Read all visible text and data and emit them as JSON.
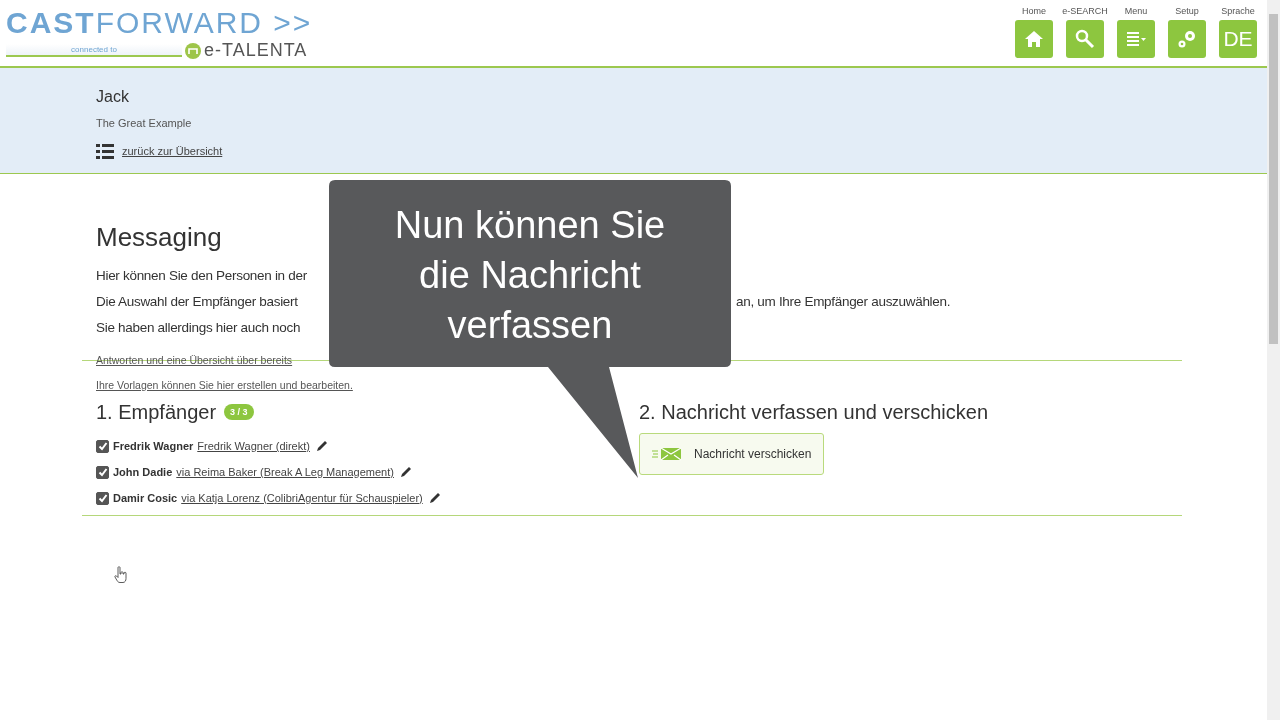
{
  "logo": {
    "title": "**CAST**FORWARD >>",
    "tagline": "connected to",
    "partner": "e-TALENTA"
  },
  "nav": [
    {
      "label": "Home",
      "kind": "home"
    },
    {
      "label": "e-SEARCH",
      "kind": "search"
    },
    {
      "label": "Menu",
      "kind": "menu"
    },
    {
      "label": "Setup",
      "kind": "setup"
    },
    {
      "label": "Sprache",
      "kind": "text",
      "text": "DE"
    }
  ],
  "profile": {
    "name": "Jack",
    "subtitle": "The Great Example",
    "back_link": "zurück zur Übersicht"
  },
  "messaging": {
    "title": "Messaging",
    "lines": [
      {
        "start": "Hier können Sie den Personen in der"
      },
      {
        "start": "Die Auswahl der Empfänger basiert",
        "end": "an, um Ihre Empfänger auszuwählen."
      },
      {
        "start": "Sie haben allerdings hier auch noch"
      }
    ],
    "links": [
      "Antworten und eine Übersicht über bereits",
      "Ihre Vorlagen können Sie hier erstellen und bearbeiten."
    ]
  },
  "recipients": {
    "title": "1. Empfänger",
    "count": "3 / 3",
    "items": [
      {
        "name": "Fredrik Wagner",
        "via": "Fredrik Wagner (direkt)",
        "checked": true
      },
      {
        "name": "John Dadie",
        "via": "via Reima Baker (Break A Leg Management)",
        "checked": true
      },
      {
        "name": "Damir Cosic",
        "via": "via Katja Lorenz (ColibriAgentur für Schauspieler)",
        "checked": true
      }
    ]
  },
  "compose": {
    "title": "2. Nachricht verfassen und verschicken",
    "button": "Nachricht verschicken"
  },
  "callout": {
    "text": "Nun können Sie\ndie Nachricht\nverfassen"
  }
}
